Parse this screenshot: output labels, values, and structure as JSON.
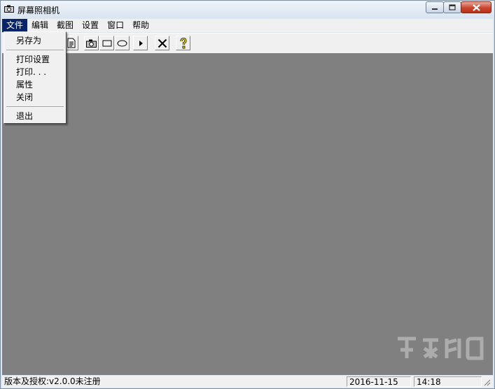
{
  "window": {
    "title": "屏幕照相机"
  },
  "menubar": {
    "items": [
      {
        "label": "文件"
      },
      {
        "label": "编辑"
      },
      {
        "label": "截图"
      },
      {
        "label": "设置"
      },
      {
        "label": "窗口"
      },
      {
        "label": "帮助"
      }
    ]
  },
  "file_menu": {
    "save_as": "另存为",
    "print_setup": "打印设置",
    "print": "打印. . .",
    "properties": "属性",
    "close": "关闭",
    "exit": "退出"
  },
  "toolbar": {
    "buttons": [
      {
        "icon": "document-icon"
      },
      {
        "icon": "camera-icon"
      },
      {
        "icon": "rectangle-icon"
      },
      {
        "icon": "ellipse-icon"
      },
      {
        "icon": "play-arrow-icon"
      },
      {
        "icon": "close-x-icon"
      },
      {
        "icon": "help-key-icon"
      }
    ]
  },
  "statusbar": {
    "version": "版本及授权:v2.0.0未注册",
    "date": "2016-11-15",
    "time": "14:18"
  },
  "colors": {
    "workspace": "#808080",
    "menu_highlight": "#0a246a",
    "chrome": "#f0f0f0",
    "close_button": "#c9452e"
  }
}
